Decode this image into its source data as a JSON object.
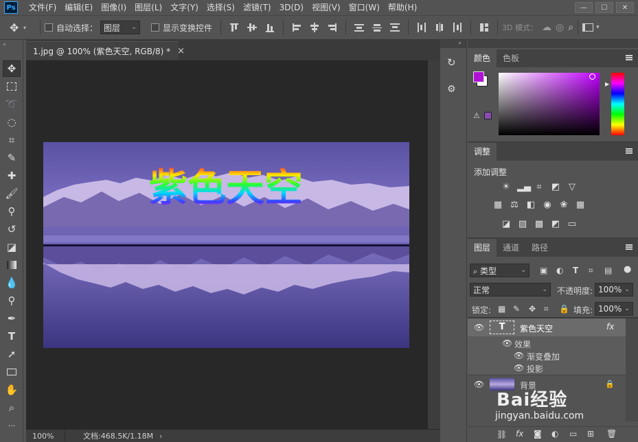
{
  "app": {
    "logo": "Ps"
  },
  "menu": [
    "文件(F)",
    "编辑(E)",
    "图像(I)",
    "图层(L)",
    "文字(Y)",
    "选择(S)",
    "滤镜(T)",
    "3D(D)",
    "视图(V)",
    "窗口(W)",
    "帮助(H)"
  ],
  "window_buttons": [
    "—",
    "☐",
    "✕"
  ],
  "options": {
    "auto_select_label": "自动选择：",
    "auto_select_value": "图层",
    "show_transform_label": "显示变换控件",
    "mode3d_label": "3D 模式："
  },
  "document": {
    "tab_title": "1.jpg @ 100% (紫色天空, RGB/8) *",
    "tab_close": "×",
    "canvas_text": "紫色天空",
    "zoom": "100%",
    "doc_info": "文档:468.5K/1.18M"
  },
  "color_panel": {
    "tabs": [
      "颜色",
      "色板"
    ],
    "fg_color": "#b012d6",
    "bg_color": "#ffffff"
  },
  "adjust_panel": {
    "tab": "调整",
    "title": "添加调整"
  },
  "layers_panel": {
    "tabs": [
      "图层",
      "通道",
      "路径"
    ],
    "filter_label": "类型",
    "blend_mode": "正常",
    "opacity_label": "不透明度:",
    "opacity_value": "100%",
    "lock_label": "锁定:",
    "fill_label": "填充:",
    "fill_value": "100%",
    "layers": [
      {
        "name": "紫色天空",
        "type": "text",
        "fx": "fx"
      },
      {
        "name": "效果"
      },
      {
        "name": "渐变叠加"
      },
      {
        "name": "投影"
      },
      {
        "name": "背景",
        "type": "image"
      }
    ]
  },
  "watermark": {
    "brand": "Bai经验",
    "url": "jingyan.baidu.com"
  }
}
